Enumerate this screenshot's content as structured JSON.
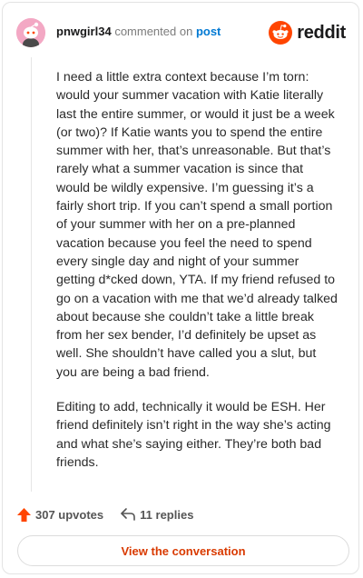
{
  "header": {
    "username": "pnwgirl34",
    "commented_on": "commented on",
    "post_link": "post",
    "brand": "reddit"
  },
  "comment": {
    "paragraphs": [
      "I need a little extra context because I’m torn: would your summer vacation with Katie literally last the entire summer, or would it just be a week (or two)? If Katie wants you to spend the entire summer with her, that’s unreasonable. But that’s rarely what a summer vacation is since that would be wildly expensive. I’m guessing it’s a fairly short trip. If you can’t spend a small portion of your summer with her on a pre-planned vacation because you feel the need to spend every single day and night of your summer getting d*cked down, YTA. If my friend refused to go on a vacation with me that we’d already talked about because she couldn’t take a little break from her sex bender, I’d definitely be upset as well. She shouldn’t have called you a slut, but you are being a bad friend.",
      "Editing to add, technically it would be ESH. Her friend definitely isn’t right in the way she’s acting and what she’s saying either. They’re both bad friends."
    ]
  },
  "actions": {
    "upvotes": "307 upvotes",
    "replies": "11 replies"
  },
  "footer": {
    "view_conversation": "View the conversation"
  },
  "colors": {
    "reddit_orange": "#ff4500",
    "link_blue": "#0079d3",
    "button_text": "#d93a00",
    "avatar_pink": "#f3a8c4"
  },
  "icons": {
    "avatar": "snoo-avatar",
    "logo": "reddit-snoo-icon",
    "upvote": "upvote-arrow-icon",
    "reply": "reply-arrow-icon"
  }
}
